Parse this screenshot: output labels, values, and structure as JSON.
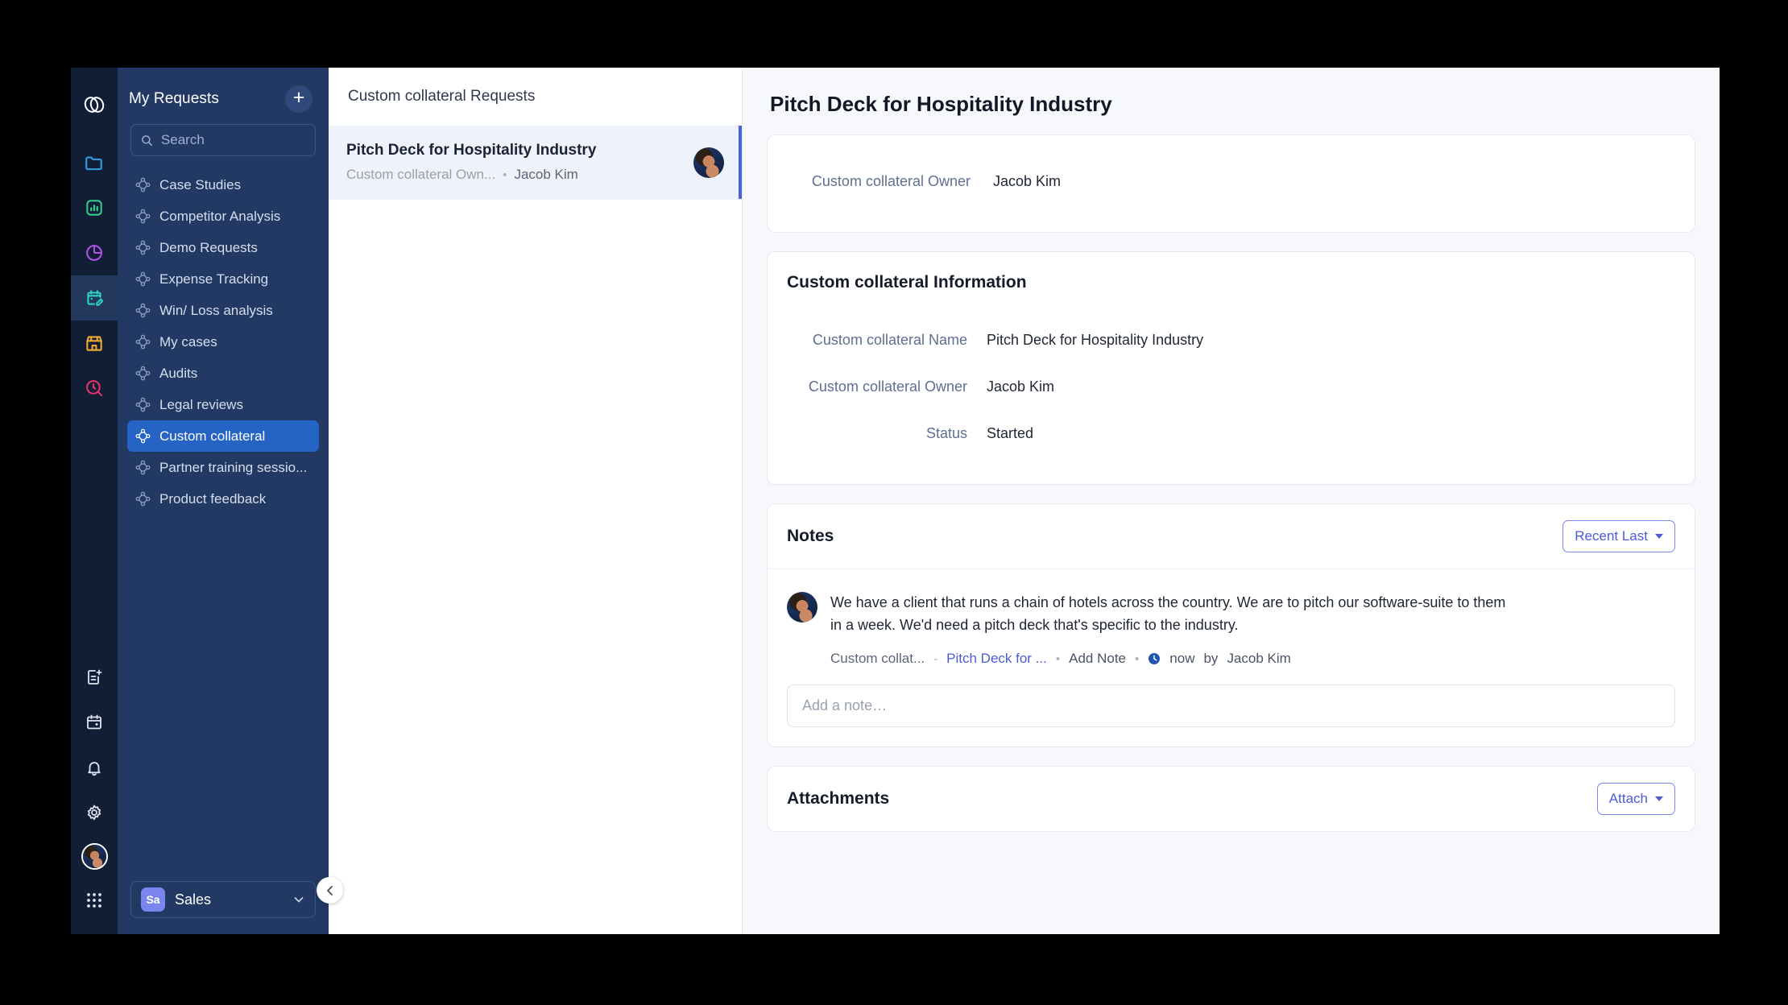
{
  "rail": {
    "logo": "app-logo",
    "icons": [
      {
        "name": "folder-icon",
        "color": "#2f9fe8"
      },
      {
        "name": "bar-chart-icon",
        "color": "#35c98a"
      },
      {
        "name": "pie-chart-icon",
        "color": "#b054e8"
      },
      {
        "name": "calendar-edit-icon",
        "color": "#2fd3c0",
        "active": true
      },
      {
        "name": "storefront-icon",
        "color": "#f0ac32"
      },
      {
        "name": "search-clock-icon",
        "color": "#e8356d"
      }
    ],
    "bottom_icons": [
      {
        "name": "new-document-icon",
        "color": "#dfe5f0"
      },
      {
        "name": "calendar-icon",
        "color": "#dfe5f0"
      },
      {
        "name": "bell-icon",
        "color": "#dfe5f0"
      },
      {
        "name": "gear-icon",
        "color": "#dfe5f0"
      },
      {
        "name": "user-avatar",
        "color": "#ffffff"
      },
      {
        "name": "grid-apps-icon",
        "color": "#dfe5f0"
      }
    ]
  },
  "sidebar": {
    "title": "My Requests",
    "add_button_label": "+",
    "search": {
      "placeholder": "Search",
      "value": ""
    },
    "items": [
      {
        "label": "Case Studies",
        "active": false
      },
      {
        "label": "Competitor Analysis",
        "active": false
      },
      {
        "label": "Demo Requests",
        "active": false
      },
      {
        "label": "Expense Tracking",
        "active": false
      },
      {
        "label": "Win/ Loss analysis",
        "active": false
      },
      {
        "label": "My cases",
        "active": false
      },
      {
        "label": "Audits",
        "active": false
      },
      {
        "label": "Legal reviews",
        "active": false
      },
      {
        "label": "Custom collateral",
        "active": true
      },
      {
        "label": "Partner training sessio...",
        "active": false
      },
      {
        "label": "Product feedback",
        "active": false
      }
    ],
    "workspace": {
      "badge": "Sa",
      "name": "Sales",
      "badge_color": "#7a86ee"
    },
    "collapse_label": "‹"
  },
  "request_list": {
    "header": "Custom collateral Requests",
    "items": [
      {
        "title": "Pitch Deck for Hospitality Industry",
        "meta_label": "Custom collateral Own...",
        "meta_value": "Jacob Kim",
        "selected": true
      }
    ]
  },
  "detail": {
    "title": "Pitch Deck for Hospitality Industry",
    "owner_card": {
      "label": "Custom collateral Owner",
      "value": "Jacob Kim"
    },
    "info_card": {
      "title": "Custom collateral Information",
      "fields": [
        {
          "label": "Custom collateral Name",
          "value": "Pitch Deck for Hospitality Industry"
        },
        {
          "label": "Custom collateral Owner",
          "value": "Jacob Kim"
        },
        {
          "label": "Status",
          "value": "Started"
        }
      ]
    },
    "notes": {
      "title": "Notes",
      "sort_label": "Recent Last",
      "entry": {
        "text": "We have a client that runs a chain of hotels across the country. We are to pitch our software-suite to them in a week. We'd need a pitch deck that's specific to the industry.",
        "meta_object": "Custom collat...",
        "meta_record": "Pitch Deck for ...",
        "meta_action": "Add Note",
        "meta_time": "now",
        "meta_by": "by",
        "meta_author": "Jacob Kim",
        "separator": "-",
        "dot": "•"
      },
      "input_placeholder": "Add a note…",
      "input_value": ""
    },
    "attachments": {
      "title": "Attachments",
      "attach_label": "Attach"
    }
  },
  "colors": {
    "accent_blue": "#2563c4",
    "link_indigo": "#4a5bd4",
    "sidebar_bg": "#223963",
    "rail_bg": "#111e35",
    "detail_bg": "#f6f8fc"
  }
}
